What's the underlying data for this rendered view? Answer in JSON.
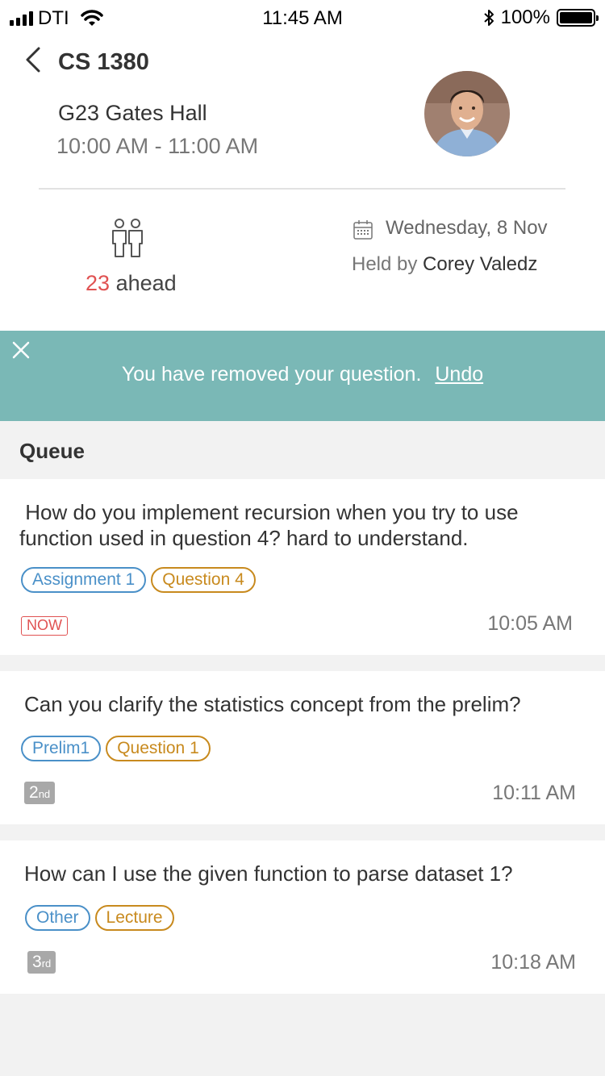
{
  "status_bar": {
    "carrier": "DTI",
    "time": "11:45 AM",
    "battery": "100%"
  },
  "header": {
    "course": "CS 1380",
    "location": "G23 Gates Hall",
    "time_range": "10:00 AM - 11:00 AM",
    "ahead_count": "23",
    "ahead_label": "ahead",
    "date": "Wednesday, 8 Nov",
    "held_by_label": "Held by",
    "host_name": "Corey Valedz"
  },
  "banner": {
    "message": "You have removed your question.",
    "undo_label": "Undo",
    "color": "#7ab8b6"
  },
  "queue": {
    "title": "Queue",
    "items": [
      {
        "question": "How do you implement recursion when you try to use function used in question 4? hard to  understand.",
        "tags": [
          "Assignment 1",
          "Question 4"
        ],
        "badge": "NOW",
        "time": "10:05 AM"
      },
      {
        "question": "Can you clarify the statistics concept from the prelim?",
        "tags": [
          "Prelim1",
          "Question 1"
        ],
        "position": "2",
        "position_suffix": "nd",
        "time": "10:11 AM"
      },
      {
        "question": "How can I use the given function to parse dataset 1?",
        "tags": [
          "Other",
          "Lecture"
        ],
        "position": "3",
        "position_suffix": "rd",
        "time": "10:18 AM"
      }
    ]
  },
  "colors": {
    "accent_red": "#e05252",
    "tag_blue": "#4a90c8",
    "tag_gold": "#c88a1e"
  }
}
